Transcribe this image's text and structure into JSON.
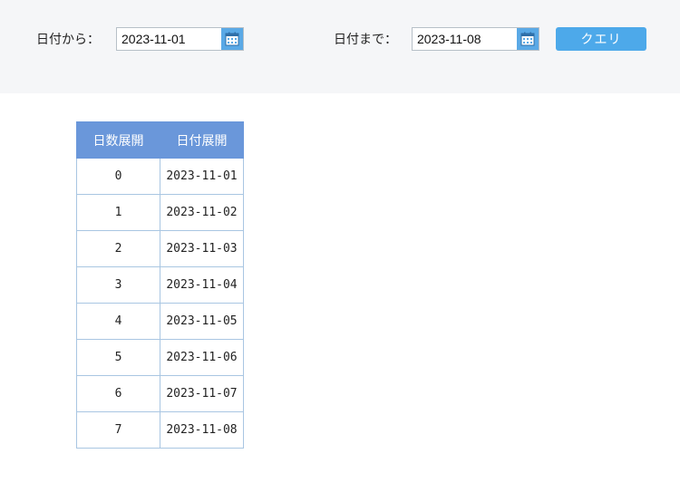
{
  "filter": {
    "from_label": "日付から：",
    "from_value": "2023-11-01",
    "to_label": "日付まで：",
    "to_value": "2023-11-08",
    "query_button": "クエリ"
  },
  "table": {
    "headers": [
      "日数展開",
      "日付展開"
    ],
    "rows": [
      [
        "0",
        "2023-11-01"
      ],
      [
        "1",
        "2023-11-02"
      ],
      [
        "2",
        "2023-11-03"
      ],
      [
        "3",
        "2023-11-04"
      ],
      [
        "4",
        "2023-11-05"
      ],
      [
        "5",
        "2023-11-06"
      ],
      [
        "6",
        "2023-11-07"
      ],
      [
        "7",
        "2023-11-08"
      ]
    ]
  },
  "colors": {
    "header_bg": "#6a97da",
    "button_bg": "#4da9ea",
    "calendar_icon_bg": "#5aa9e6"
  }
}
